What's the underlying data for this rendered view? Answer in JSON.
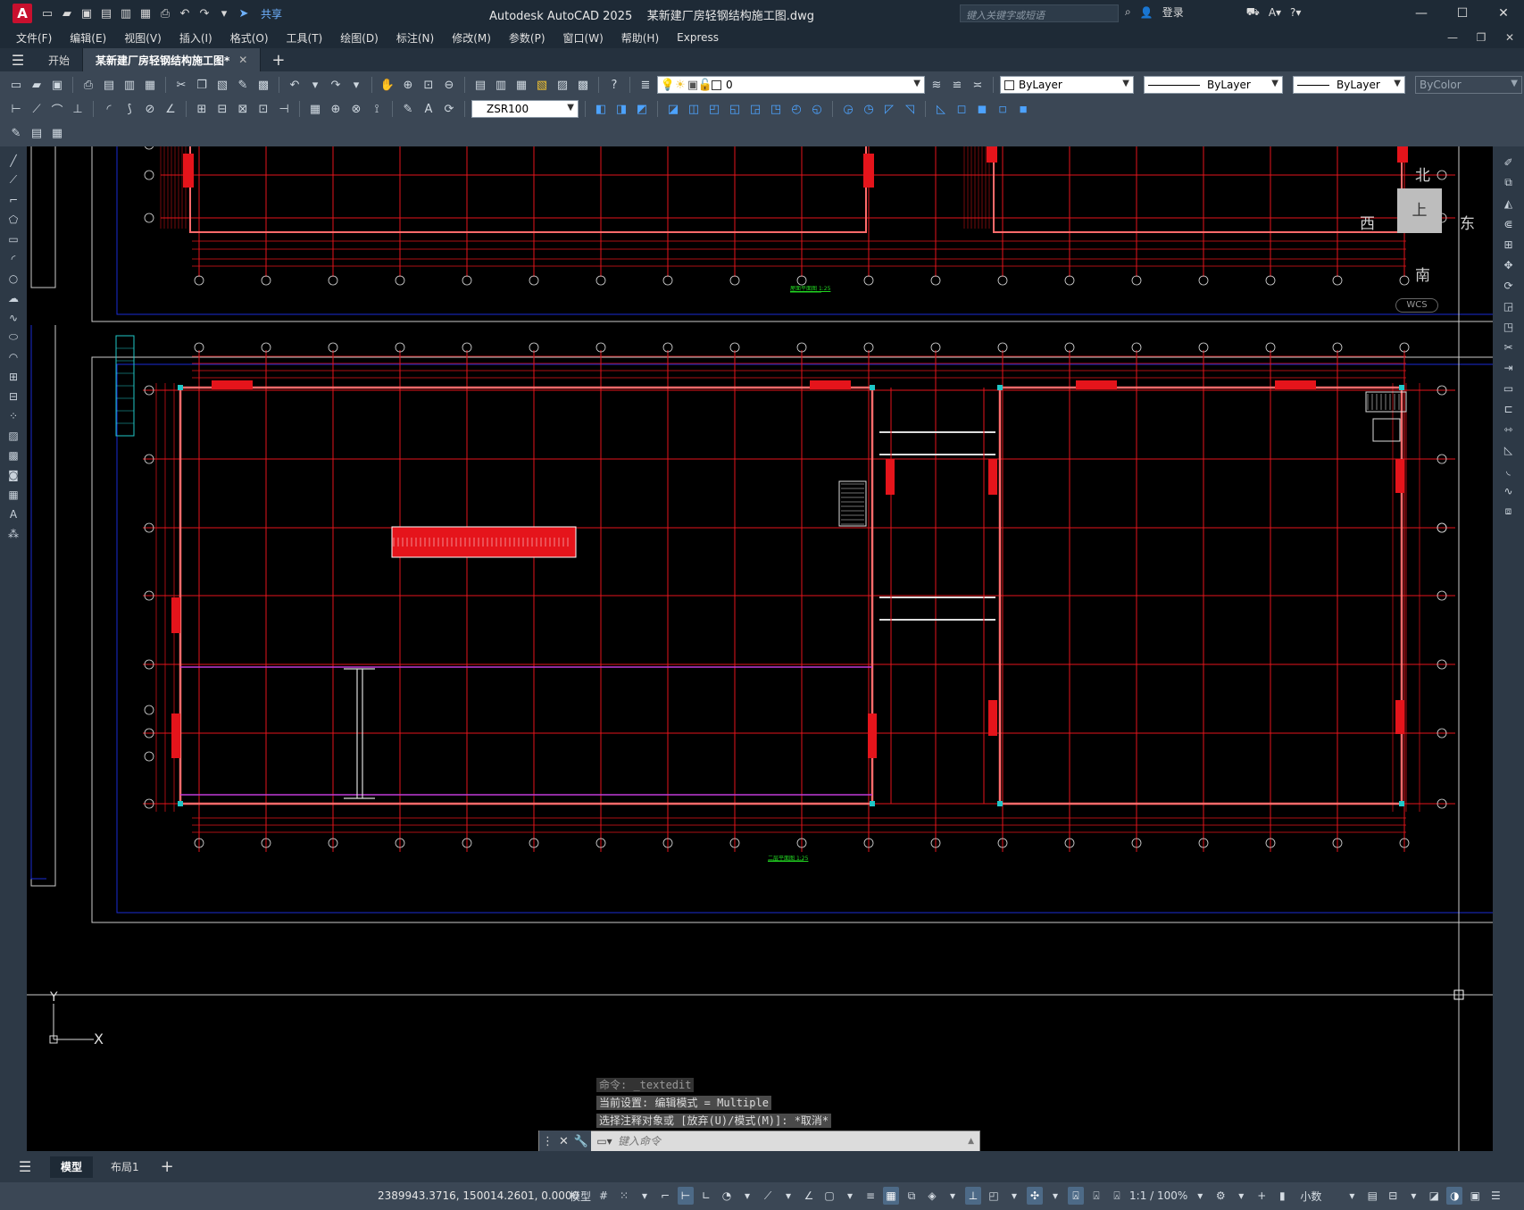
{
  "title": {
    "app_name": "Autodesk AutoCAD 2025",
    "file_name": "某新建厂房轻钢结构施工图.dwg",
    "share_label": "共享",
    "search_placeholder": "键入关键字或短语",
    "login_label": "登录"
  },
  "menu": [
    "文件(F)",
    "编辑(E)",
    "视图(V)",
    "插入(I)",
    "格式(O)",
    "工具(T)",
    "绘图(D)",
    "标注(N)",
    "修改(M)",
    "参数(P)",
    "窗口(W)",
    "帮助(H)",
    "Express"
  ],
  "tabs": {
    "start": "开始",
    "document": "某新建厂房轻钢结构施工图*"
  },
  "properties": {
    "layer": "0",
    "color": "ByLayer",
    "linetype": "ByLayer",
    "lineweight": "ByLayer",
    "plotstyle": "ByColor",
    "dimstyle": "ZSR100"
  },
  "viewcube": {
    "north": "北",
    "south": "南",
    "east": "东",
    "west": "西",
    "top": "上",
    "wcs": "WCS"
  },
  "ucs": {
    "x_label": "X",
    "y_label": "Y"
  },
  "drawing": {
    "plan_title_upper": "屋面平面图",
    "plan_title_lower": "二层平面图",
    "scale_upper": "1:25",
    "scale_lower": "1:25"
  },
  "command": {
    "history": [
      "命令: _textedit",
      "当前设置: 编辑模式 = Multiple",
      "选择注释对象或 [放弃(U)/模式(M)]: *取消*"
    ],
    "prompt_placeholder": "键入命令"
  },
  "layout_tabs": [
    "模型",
    "布局1"
  ],
  "status": {
    "coordinates": "2389943.3716, 150014.2601, 0.0000",
    "mode": "模型",
    "scale": "1:1 / 100%",
    "units": "小数"
  },
  "colors": {
    "grid_red": "#e5141b",
    "frame_blue": "#1a2bd4",
    "cyan": "#20c7c7",
    "magenta": "#c03ad8",
    "ui_dark": "#1e2a36",
    "ui_mid": "#3b4755"
  }
}
